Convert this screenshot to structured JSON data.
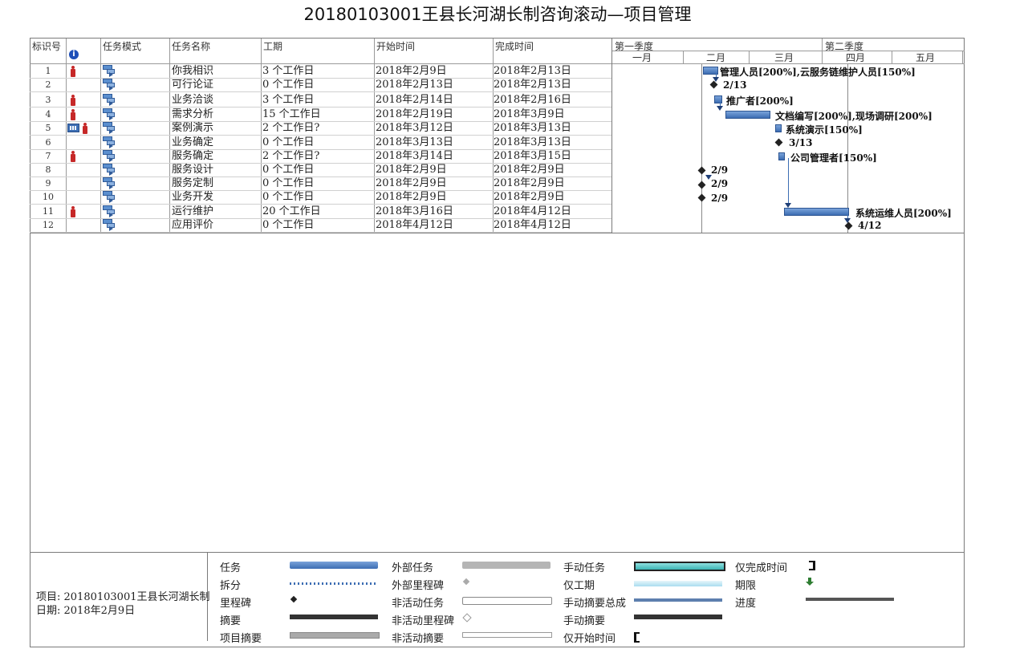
{
  "title": "20180103001王县长河湖长制咨询滚动—项目管理",
  "table": {
    "headers": {
      "id": "标识号",
      "mode": "任务模式",
      "name": "任务名称",
      "duration": "工期",
      "start": "开始时间",
      "finish": "完成时间"
    },
    "rows": [
      {
        "id": "1",
        "name": "你我相识",
        "duration": "3 个工作日",
        "start": "2018年2月9日",
        "finish": "2018年2月13日",
        "person": true,
        "calendar": false
      },
      {
        "id": "2",
        "name": "可行论证",
        "duration": "0 个工作日",
        "start": "2018年2月13日",
        "finish": "2018年2月13日",
        "person": false,
        "calendar": false
      },
      {
        "id": "3",
        "name": "业务洽谈",
        "duration": "3 个工作日",
        "start": "2018年2月14日",
        "finish": "2018年2月16日",
        "person": true,
        "calendar": false
      },
      {
        "id": "4",
        "name": "需求分析",
        "duration": "15 个工作日",
        "start": "2018年2月19日",
        "finish": "2018年3月9日",
        "person": true,
        "calendar": false
      },
      {
        "id": "5",
        "name": "案例演示",
        "duration": "2 个工作日?",
        "start": "2018年3月12日",
        "finish": "2018年3月13日",
        "person": true,
        "calendar": true
      },
      {
        "id": "6",
        "name": "业务确定",
        "duration": "0 个工作日",
        "start": "2018年3月13日",
        "finish": "2018年3月13日",
        "person": false,
        "calendar": false
      },
      {
        "id": "7",
        "name": "服务确定",
        "duration": "2 个工作日?",
        "start": "2018年3月14日",
        "finish": "2018年3月15日",
        "person": true,
        "calendar": false
      },
      {
        "id": "8",
        "name": "服务设计",
        "duration": "0 个工作日",
        "start": "2018年2月9日",
        "finish": "2018年2月9日",
        "person": false,
        "calendar": false
      },
      {
        "id": "9",
        "name": "服务定制",
        "duration": "0 个工作日",
        "start": "2018年2月9日",
        "finish": "2018年2月9日",
        "person": false,
        "calendar": false
      },
      {
        "id": "10",
        "name": "业务开发",
        "duration": "0 个工作日",
        "start": "2018年2月9日",
        "finish": "2018年2月9日",
        "person": false,
        "calendar": false
      },
      {
        "id": "11",
        "name": "运行维护",
        "duration": "20 个工作日",
        "start": "2018年3月16日",
        "finish": "2018年4月12日",
        "person": true,
        "calendar": false
      },
      {
        "id": "12",
        "name": "应用评价",
        "duration": "0 个工作日",
        "start": "2018年4月12日",
        "finish": "2018年4月12日",
        "person": false,
        "calendar": false
      }
    ]
  },
  "timescale": {
    "quarters": [
      "第一季度",
      "第二季度"
    ],
    "months": [
      "一月",
      "二月",
      "三月",
      "四月",
      "五月"
    ]
  },
  "gantt": {
    "labels": [
      "管理人员[200%],云服务链维护人员[150%]",
      "2/13",
      "推广者[200%]",
      "文档编写[200%],现场调研[200%]",
      "系统演示[150%]",
      "3/13",
      "公司管理者[150%]",
      "2/9",
      "2/9",
      "2/9",
      "系统运维人员[200%]",
      "4/12"
    ]
  },
  "footer": {
    "project": "项目: 20180103001王县长河湖长制",
    "date": "日期: 2018年2月9日"
  },
  "legend": {
    "col1": [
      "任务",
      "拆分",
      "里程碑",
      "摘要",
      "项目摘要"
    ],
    "col2": [
      "外部任务",
      "外部里程碑",
      "非活动任务",
      "非活动里程碑",
      "非活动摘要"
    ],
    "col3": [
      "手动任务",
      "仅工期",
      "手动摘要总成",
      "手动摘要",
      "仅开始时间"
    ],
    "col4": [
      "仅完成时间",
      "期限",
      "进度"
    ]
  },
  "colors": {
    "task_bar": "#3c6db3",
    "resource_icon": "#c62828",
    "manual_task": "#3cb4b4",
    "deadline": "#2e7d32"
  }
}
